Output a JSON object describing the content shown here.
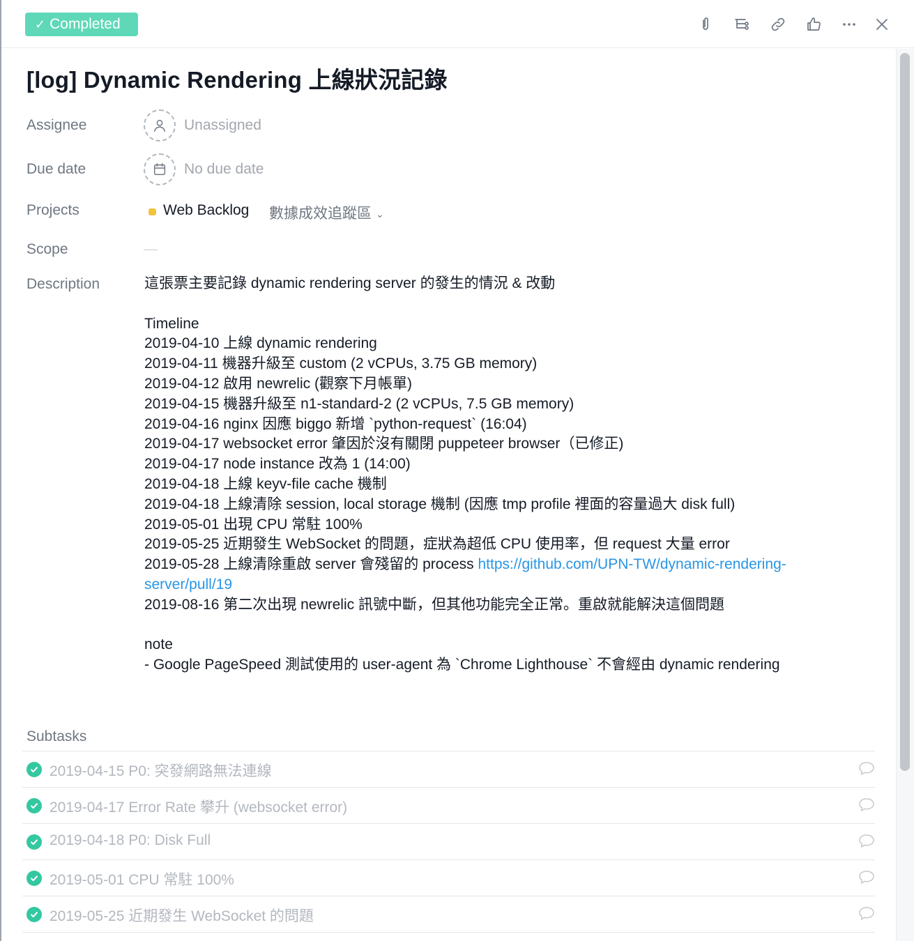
{
  "header": {
    "completed_label": "Completed",
    "toolbar_icons": [
      "paperclip-icon",
      "subtask-icon",
      "link-icon",
      "thumbs-up-icon",
      "more-icon",
      "close-icon"
    ]
  },
  "task": {
    "title": "[log] Dynamic Rendering 上線狀況記錄"
  },
  "fields": {
    "assignee_label": "Assignee",
    "assignee_value": "Unassigned",
    "due_label": "Due date",
    "due_value": "No due date",
    "projects_label": "Projects",
    "project_name": "Web Backlog",
    "project_color": "#f1c33c",
    "project_section": "數據成效追蹤區",
    "scope_label": "Scope",
    "description_label": "Description"
  },
  "description": {
    "intro": "這張票主要記錄 dynamic rendering server 的發生的情況 & 改動",
    "timeline_heading": "Timeline",
    "timeline": [
      "2019-04-10 上線 dynamic rendering",
      "2019-04-11 機器升級至 custom (2 vCPUs, 3.75 GB memory)",
      "2019-04-12 啟用 newrelic (觀察下月帳單)",
      "2019-04-15 機器升級至 n1-standard-2 (2 vCPUs, 7.5 GB memory)",
      "2019-04-16 nginx 因應 biggo 新增 `python-request` (16:04)",
      "2019-04-17 websocket error 肇因於沒有關閉 puppeteer browser（已修正)",
      "2019-04-17 node instance 改為 1 (14:00)",
      "2019-04-18 上線 keyv-file cache 機制",
      "2019-04-18 上線清除 session, local storage 機制 (因應 tmp profile 裡面的容量過大 disk full)",
      "2019-05-01 出現 CPU 常駐 100%",
      "2019-05-25 近期發生 WebSocket 的問題，症狀為超低 CPU 使用率，但 request 大量 error"
    ],
    "timeline_link_prefix": "2019-05-28 上線清除重啟 server 會殘留的 process ",
    "timeline_link": "https://github.com/UPN-TW/dynamic-rendering-server/pull/19",
    "timeline_last": "2019-08-16 第二次出現 newrelic 訊號中斷，但其他功能完全正常。重啟就能解決這個問題",
    "note_heading": "note",
    "note_line": "- Google PageSpeed 測試使用的 user-agent 為 `Chrome Lighthouse` 不會經由 dynamic rendering"
  },
  "subtasks": {
    "label": "Subtasks",
    "items": [
      {
        "name": "2019-04-15 P0: 突發網路無法連線"
      },
      {
        "name": "2019-04-17 Error Rate 攀升 (websocket error)"
      },
      {
        "name": "2019-04-18 P0: Disk Full"
      },
      {
        "name": "2019-05-01 CPU 常駐 100%"
      },
      {
        "name": "2019-05-25 近期發生 WebSocket 的問題"
      }
    ]
  }
}
